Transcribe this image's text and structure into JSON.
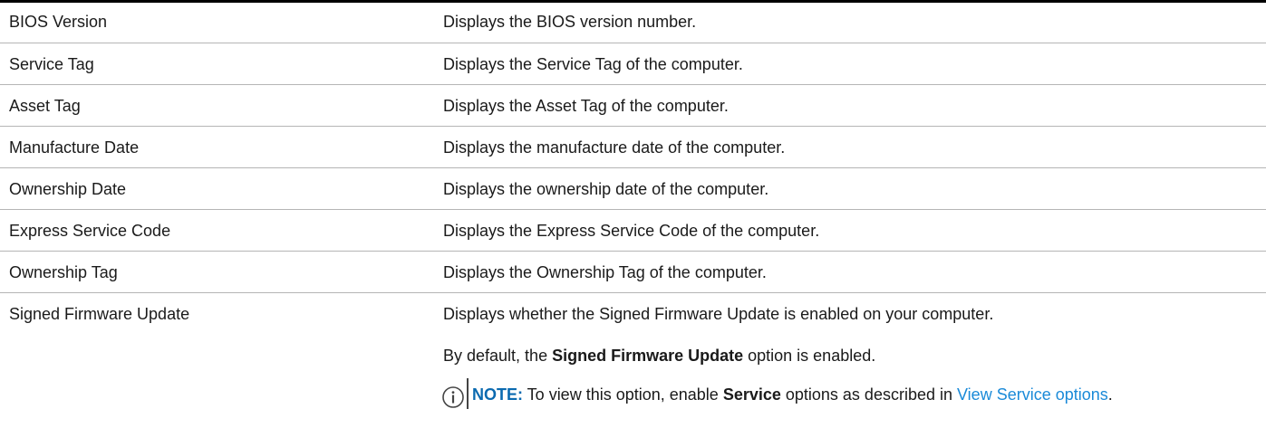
{
  "rows": [
    {
      "name": "BIOS Version",
      "description": "Displays the BIOS version number."
    },
    {
      "name": "Service Tag",
      "description": "Displays the Service Tag of the computer."
    },
    {
      "name": "Asset Tag",
      "description": "Displays the Asset Tag of the computer."
    },
    {
      "name": "Manufacture Date",
      "description": "Displays the manufacture date of the computer."
    },
    {
      "name": "Ownership Date",
      "description": "Displays the ownership date of the computer."
    },
    {
      "name": "Express Service Code",
      "description": "Displays the Express Service Code of the computer."
    },
    {
      "name": "Ownership Tag",
      "description": "Displays the Ownership Tag of the computer."
    }
  ],
  "last_row": {
    "name": "Signed Firmware Update",
    "description": "Displays whether the Signed Firmware Update is enabled on your computer.",
    "default_prefix": "By default, the ",
    "default_bold": "Signed Firmware Update",
    "default_suffix": " option is enabled.",
    "note": {
      "icon": "info-icon",
      "label": "NOTE:",
      "text_prefix": " To view this option, enable ",
      "text_bold": "Service",
      "text_middle": " options as described in ",
      "link_text": "View Service options",
      "text_suffix": "."
    }
  },
  "colors": {
    "rule": "#000000",
    "divider": "#b5b5b5",
    "note_label": "#0b6ab0",
    "link": "#1a8ad8"
  }
}
